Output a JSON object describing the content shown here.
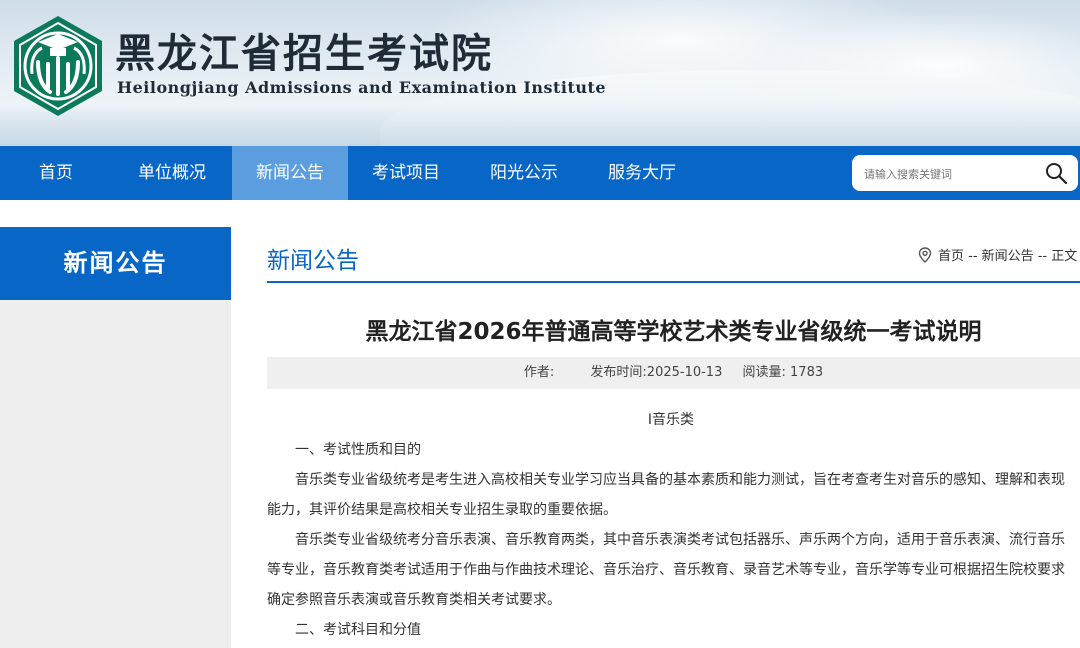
{
  "header": {
    "title_cn": "黑龙江省招生考试院",
    "title_en": "Heilongjiang Admissions and Examination Institute",
    "logo_icon": "institute-logo-icon",
    "brand_color": "#0a7a5a"
  },
  "nav": {
    "items": [
      {
        "label": "首页"
      },
      {
        "label": "单位概况"
      },
      {
        "label": "新闻公告"
      },
      {
        "label": "考试项目"
      },
      {
        "label": "阳光公示"
      },
      {
        "label": "服务大厅"
      }
    ],
    "active_index": 2,
    "bar_color": "#0866c6",
    "active_color": "#5a9ee0"
  },
  "search": {
    "placeholder": "请输入搜索关键词",
    "icon": "search-icon"
  },
  "sidebar": {
    "title": "新闻公告"
  },
  "section": {
    "title": "新闻公告",
    "breadcrumb": "首页 -- 新闻公告 -- 正文",
    "breadcrumb_icon": "location-pin-icon"
  },
  "article": {
    "title": "黑龙江省2026年普通高等学校艺术类专业省级统一考试说明",
    "author_label": "作者:",
    "publish_label": "发布时间:",
    "publish_date": "2025-10-13",
    "reads_label": "阅读量:",
    "reads": "1783",
    "subheading": "Ⅰ音乐类",
    "section1": "一、考试性质和目的",
    "para1": "音乐类专业省级统考是考生进入高校相关专业学习应当具备的基本素质和能力测试，旨在考查考生对音乐的感知、理解和表现能力，其评价结果是高校相关专业招生录取的重要依据。",
    "para2": "音乐类专业省级统考分音乐表演、音乐教育两类，其中音乐表演类考试包括器乐、声乐两个方向，适用于音乐表演、流行音乐等专业，音乐教育类考试适用于作曲与作曲技术理论、音乐治疗、音乐教育、录音艺术等专业，音乐学等专业可根据招生院校要求确定参照音乐表演或音乐教育类相关考试要求。",
    "section2": "二、考试科目和分值"
  }
}
